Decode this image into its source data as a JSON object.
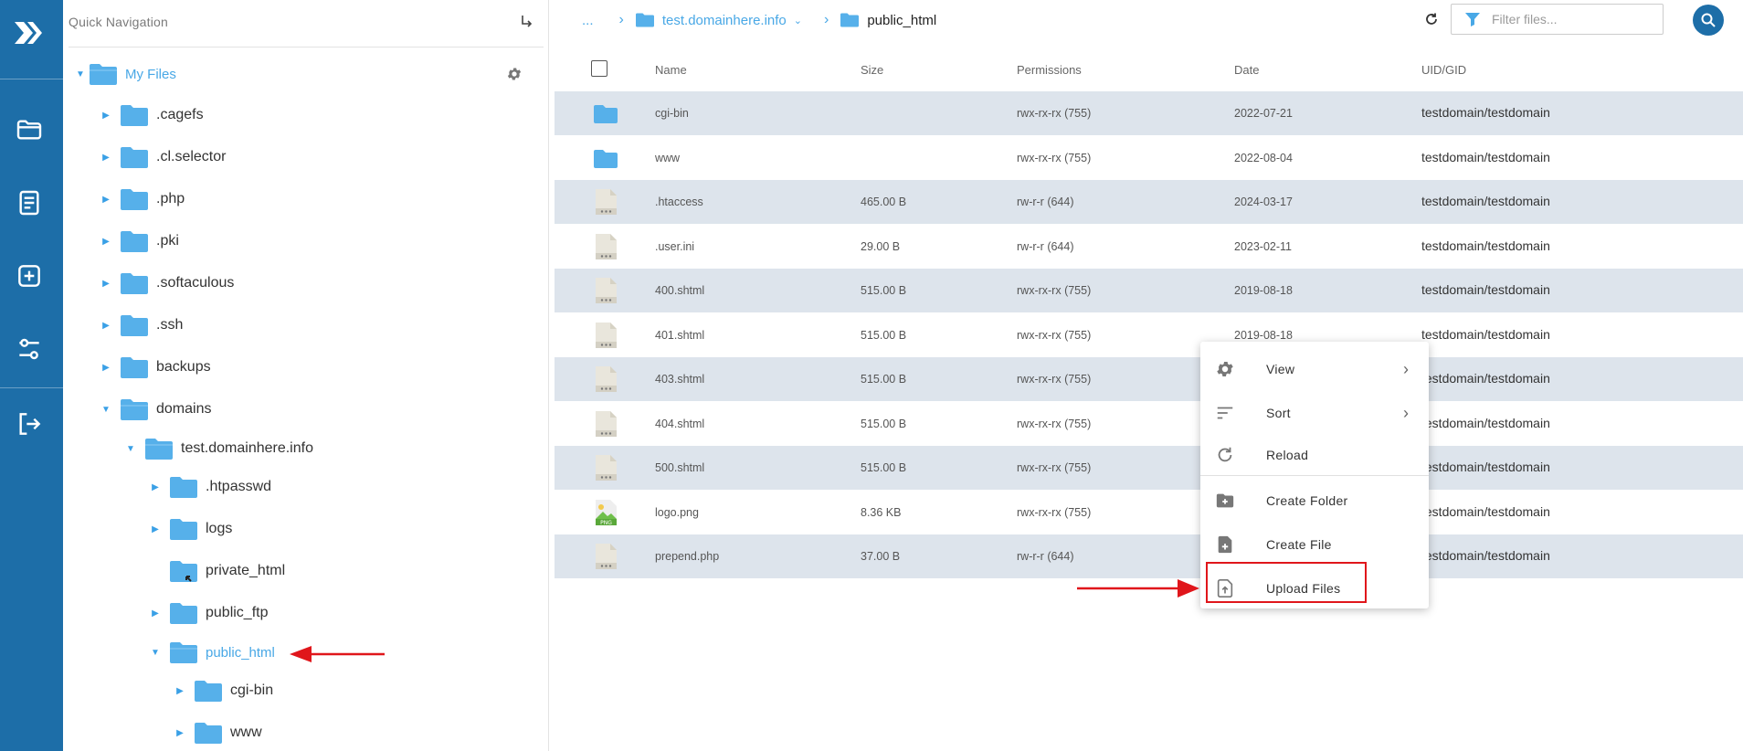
{
  "sidebar_rail": {
    "icons": [
      "logo-icon",
      "folder-icon",
      "document-icon",
      "add-box-icon",
      "settings-sliders-icon",
      "logout-icon"
    ]
  },
  "quick_nav": {
    "label": "Quick Navigation"
  },
  "tree": {
    "root": "My Files",
    "items": [
      {
        "label": ".cagefs"
      },
      {
        "label": ".cl.selector"
      },
      {
        "label": ".php"
      },
      {
        "label": ".pki"
      },
      {
        "label": ".softaculous"
      },
      {
        "label": ".ssh"
      },
      {
        "label": "backups"
      },
      {
        "label": "domains"
      },
      {
        "label": "test.domainhere.info"
      },
      {
        "label": ".htpasswd"
      },
      {
        "label": "logs"
      },
      {
        "label": "private_html"
      },
      {
        "label": "public_ftp"
      },
      {
        "label": "public_html"
      },
      {
        "label": "cgi-bin"
      },
      {
        "label": "www"
      }
    ]
  },
  "breadcrumb": {
    "ellipsis": "...",
    "parent": "test.domainhere.info",
    "current": "public_html"
  },
  "filter": {
    "placeholder": "Filter files..."
  },
  "table": {
    "headers": {
      "name": "Name",
      "size": "Size",
      "permissions": "Permissions",
      "date": "Date",
      "uid": "UID/GID"
    },
    "rows": [
      {
        "name": "cgi-bin",
        "size": "",
        "permissions": "rwx-rx-rx (755)",
        "date": "2022-07-21",
        "uid": "testdomain/testdomain",
        "type": "folder"
      },
      {
        "name": "www",
        "size": "",
        "permissions": "rwx-rx-rx (755)",
        "date": "2022-08-04",
        "uid": "testdomain/testdomain",
        "type": "folder"
      },
      {
        "name": ".htaccess",
        "size": "465.00 B",
        "permissions": "rw-r-r (644)",
        "date": "2024-03-17",
        "uid": "testdomain/testdomain",
        "type": "file"
      },
      {
        "name": ".user.ini",
        "size": "29.00 B",
        "permissions": "rw-r-r (644)",
        "date": "2023-02-11",
        "uid": "testdomain/testdomain",
        "type": "file"
      },
      {
        "name": "400.shtml",
        "size": "515.00 B",
        "permissions": "rwx-rx-rx (755)",
        "date": "2019-08-18",
        "uid": "testdomain/testdomain",
        "type": "file"
      },
      {
        "name": "401.shtml",
        "size": "515.00 B",
        "permissions": "rwx-rx-rx (755)",
        "date": "2019-08-18",
        "uid": "testdomain/testdomain",
        "type": "file"
      },
      {
        "name": "403.shtml",
        "size": "515.00 B",
        "permissions": "rwx-rx-rx (755)",
        "date": "",
        "uid": "testdomain/testdomain",
        "type": "file"
      },
      {
        "name": "404.shtml",
        "size": "515.00 B",
        "permissions": "rwx-rx-rx (755)",
        "date": "",
        "uid": "testdomain/testdomain",
        "type": "file"
      },
      {
        "name": "500.shtml",
        "size": "515.00 B",
        "permissions": "rwx-rx-rx (755)",
        "date": "",
        "uid": "testdomain/testdomain",
        "type": "file"
      },
      {
        "name": "logo.png",
        "size": "8.36 KB",
        "permissions": "rwx-rx-rx (755)",
        "date": "",
        "uid": "testdomain/testdomain",
        "type": "image"
      },
      {
        "name": "prepend.php",
        "size": "37.00 B",
        "permissions": "rw-r-r (644)",
        "date": "",
        "uid": "testdomain/testdomain",
        "type": "file"
      }
    ]
  },
  "context_menu": {
    "items": [
      {
        "label": "View",
        "icon": "gear-icon"
      },
      {
        "label": "Sort",
        "icon": "sort-icon"
      },
      {
        "label": "Reload",
        "icon": "reload-icon"
      },
      {
        "label": "Create Folder",
        "icon": "folder-plus-icon"
      },
      {
        "label": "Create File",
        "icon": "file-plus-icon"
      },
      {
        "label": "Upload Files",
        "icon": "upload-file-icon"
      }
    ]
  },
  "colors": {
    "rail": "#1d6ea8",
    "accent": "#49a8e6",
    "row_shade": "#dde4ec",
    "annotation": "#e0161b"
  }
}
